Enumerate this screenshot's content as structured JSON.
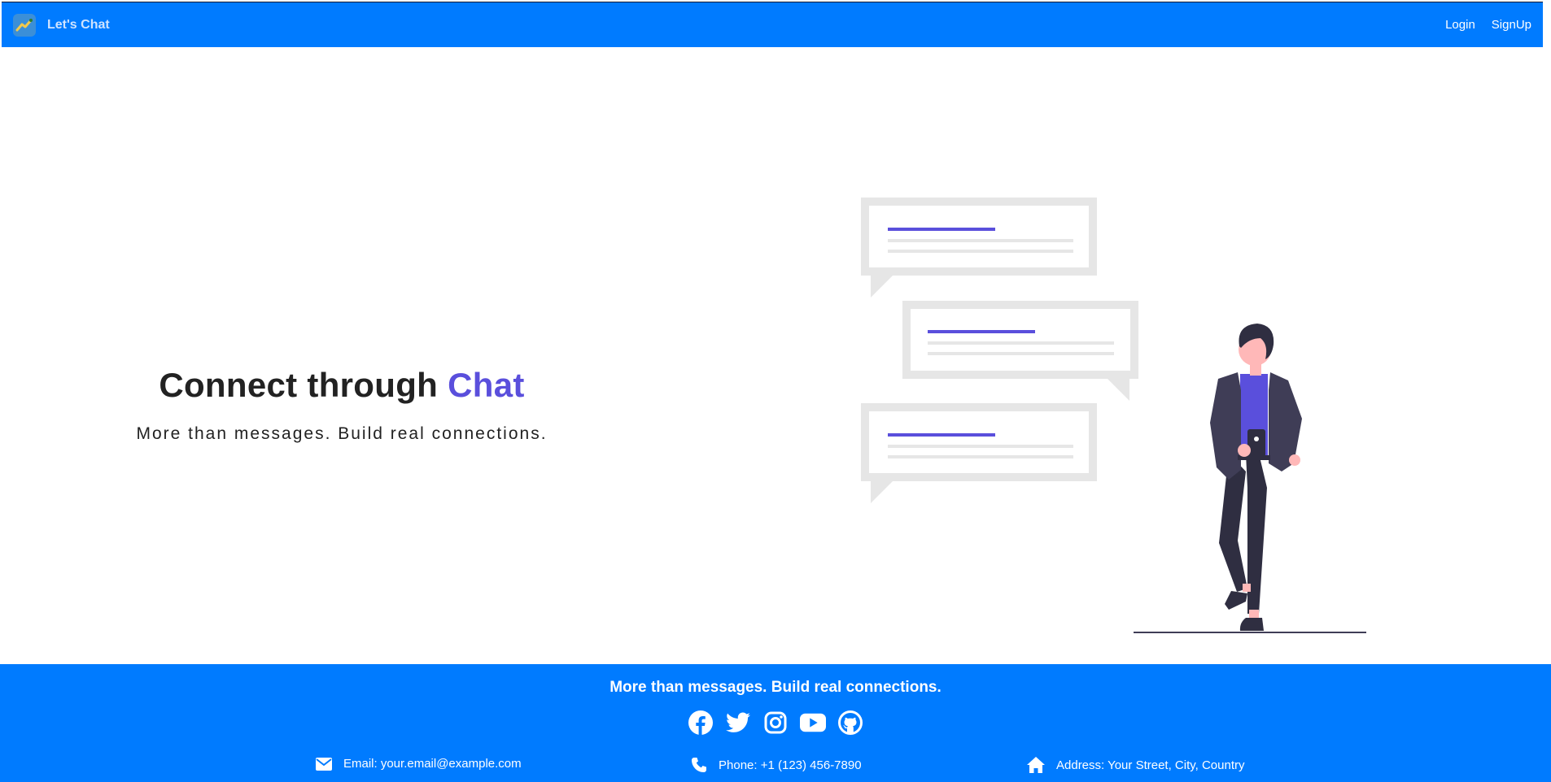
{
  "navbar": {
    "brand": "Let's Chat",
    "links": {
      "login": "Login",
      "signup": "SignUp"
    }
  },
  "hero": {
    "title_main": "Connect through",
    "title_accent": "Chat",
    "subtitle": "More than messages. Build real connections."
  },
  "footer": {
    "tagline": "More than messages. Build real connections.",
    "socials": [
      "facebook-icon",
      "twitter-icon",
      "instagram-icon",
      "youtube-icon",
      "github-icon"
    ],
    "email": "Email: your.email@example.com",
    "phone": "Phone: +1 (123) 456-7890",
    "address": "Address: Your Street, City, Country"
  },
  "colors": {
    "primary": "#007bff",
    "accent": "#5a4fdc",
    "text": "#222222"
  }
}
